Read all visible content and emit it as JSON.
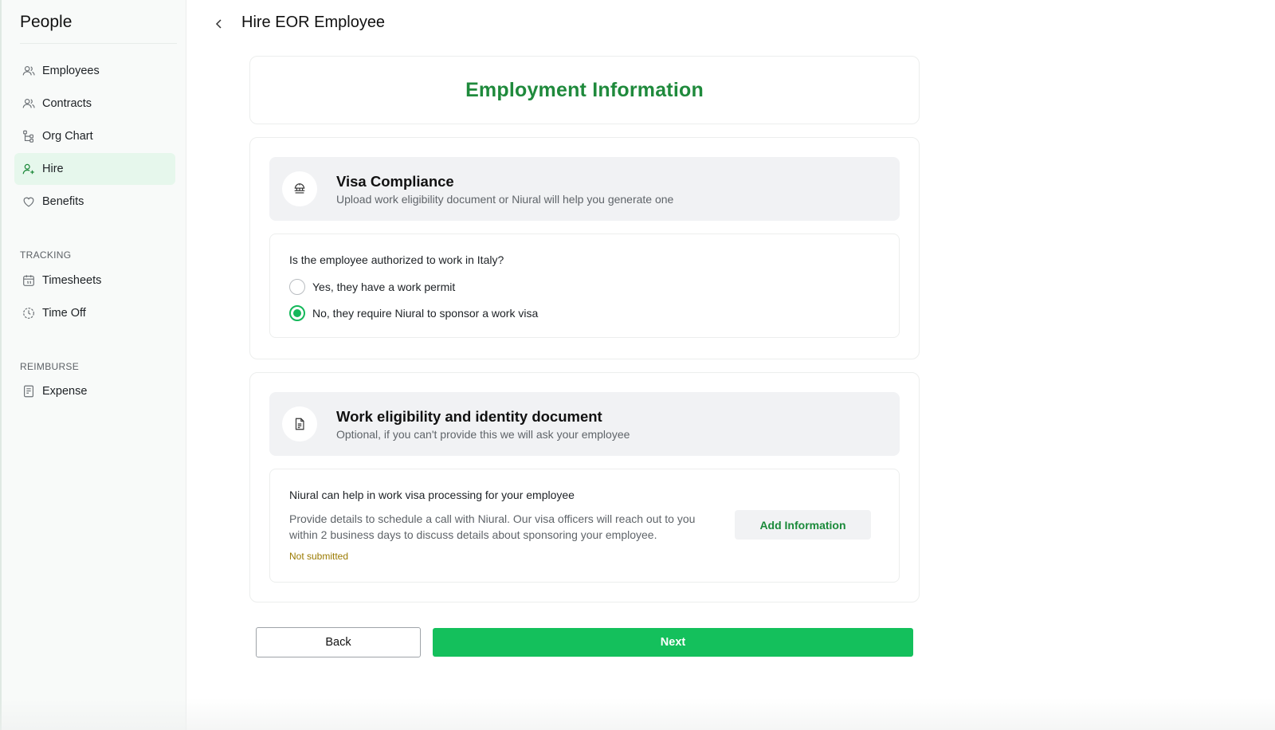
{
  "sidebar": {
    "title": "People",
    "items": [
      {
        "label": "Employees",
        "icon": "users-icon"
      },
      {
        "label": "Contracts",
        "icon": "users-icon"
      },
      {
        "label": "Org Chart",
        "icon": "org-chart-icon"
      },
      {
        "label": "Hire",
        "icon": "user-plus-icon",
        "active": true
      },
      {
        "label": "Benefits",
        "icon": "heart-icon"
      }
    ],
    "tracking_label": "TRACKING",
    "tracking_items": [
      {
        "label": "Timesheets",
        "icon": "calendar-icon"
      },
      {
        "label": "Time Off",
        "icon": "clock-icon"
      }
    ],
    "reimburse_label": "REIMBURSE",
    "reimburse_items": [
      {
        "label": "Expense",
        "icon": "receipt-icon"
      }
    ]
  },
  "header": {
    "title": "Hire EOR Employee"
  },
  "form": {
    "heading": "Employment Information",
    "visa_section": {
      "title": "Visa Compliance",
      "subtitle": "Upload work eligibility document or Niural will help you generate one",
      "icon": "visa-icon",
      "question": "Is the employee authorized to work in Italy?",
      "options": [
        {
          "label": "Yes, they have a work permit",
          "checked": false
        },
        {
          "label": "No, they require Niural to sponsor a work visa",
          "checked": true
        }
      ]
    },
    "document_section": {
      "title": "Work eligibility and identity document",
      "subtitle": "Optional, if you can't provide this we will ask your employee",
      "icon": "document-icon",
      "visa_help_title": "Niural can help in work visa processing for your employee",
      "visa_help_desc": "Provide details to schedule a call with Niural. Our visa officers will reach out to you within 2 business days to discuss details about sponsoring your employee.",
      "status": "Not submitted",
      "button_label": "Add Information"
    },
    "back_label": "Back",
    "next_label": "Next"
  },
  "colors": {
    "accent_green": "#14c05c",
    "heading_green": "#1f8a3c",
    "active_nav_bg": "#e6f7ec",
    "status_amber": "#9a7a00"
  }
}
